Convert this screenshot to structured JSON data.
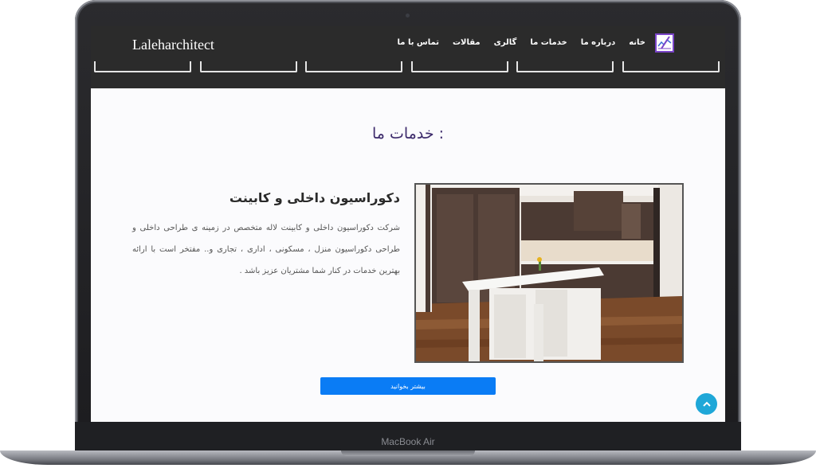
{
  "navbar": {
    "brand": "Laleharchitect",
    "menu": [
      "خانه",
      "درباره ما",
      "خدمات ما",
      "گالری",
      "مقالات",
      "تماس با ما"
    ],
    "logo_icon": "logo-chart-pen-icon"
  },
  "services": {
    "title": "خدمات ما :",
    "item_title": "دکوراسیون داخلی و کابینت",
    "item_description": "شرکت دکوراسیون داخلی و کابینت لاله متخصص در زمینه ی طراحی داخلی و طراحی دکوراسیون منزل ، مسکونی ، اداری ، تجاری و.. مفتخر است با ارائه بهترین خدمات در کنار شما مشتریان عزیز باشد .",
    "button_label": "بیشتر بخوانید",
    "image_icon": "kitchen-photo"
  },
  "device": {
    "model": "MacBook Air"
  },
  "colors": {
    "nav_bg": "#2b2b2b",
    "title": "#3c2a6b",
    "button": "#0a7cf5",
    "scroll_top": "#1fa7d8"
  }
}
